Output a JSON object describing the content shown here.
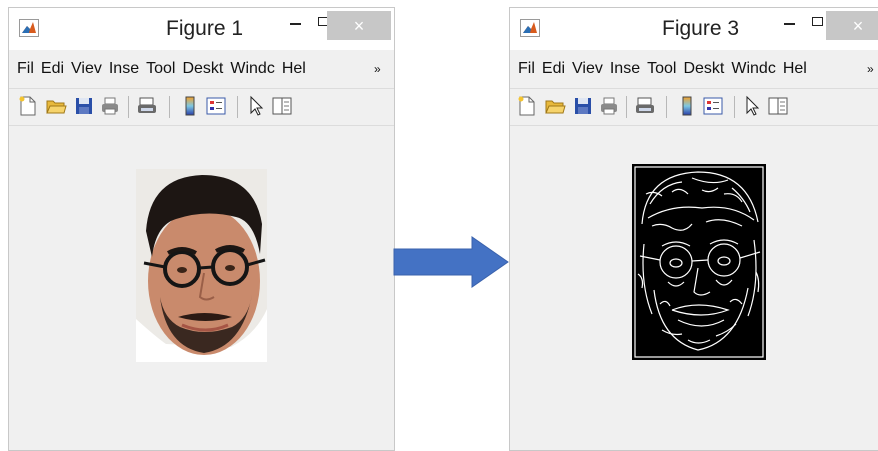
{
  "windows": [
    {
      "id": "figure-1",
      "title": "Figure 1",
      "close_glyph": "×",
      "menu": [
        "File",
        "Edi",
        "View",
        "Inser",
        "Tool",
        "Deskto",
        "Windo",
        "Help"
      ],
      "menu_labels_visible": [
        "Fil",
        "Edi",
        "Viev",
        "Inse",
        "Tool",
        "Deskt",
        "Windc",
        "Hel"
      ],
      "image": "face-photo"
    },
    {
      "id": "figure-3",
      "title": "Figure 3",
      "close_glyph": "×",
      "menu_labels_visible": [
        "Fil",
        "Edi",
        "Viev",
        "Inse",
        "Tool",
        "Deskt",
        "Windc",
        "Hel"
      ],
      "image": "edge-detected-face"
    }
  ],
  "toolbar_icons": [
    "new-file-icon",
    "open-folder-icon",
    "save-icon",
    "print-icon",
    "print-preview-icon",
    "colorbar-icon",
    "legend-icon",
    "pointer-icon",
    "property-editor-icon"
  ],
  "colors": {
    "arrow": "#4472c4",
    "window_bg": "#f0f0f0",
    "edge_bg": "#000000",
    "edge_lines": "#ffffff"
  }
}
